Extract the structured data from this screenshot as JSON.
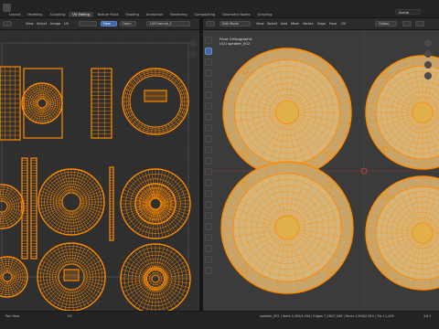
{
  "app": {
    "workspaces": [
      "Layout",
      "Modeling",
      "Sculpting",
      "UV Editing",
      "Texture Paint",
      "Shading",
      "Animation",
      "Rendering",
      "Compositing",
      "Geometry Nodes",
      "Scripting"
    ],
    "active_workspace": "UV Editing",
    "scene_name": "Scene"
  },
  "uv_editor": {
    "header": {
      "mode": "View",
      "menus": [
        "View",
        "Select",
        "Image",
        "UV"
      ],
      "pivot": "Sync",
      "image_name": "UVChannel_1",
      "shading_label": "New",
      "open_label": "Open"
    }
  },
  "viewport": {
    "header": {
      "mode": "Edit Mode",
      "menus": [
        "View",
        "Select",
        "Add",
        "Mesh",
        "Vertex",
        "Edge",
        "Face",
        "UV"
      ],
      "transform_orientation": "Global"
    },
    "overlay_title": "Front Orthographic",
    "overlay_subtitle": "(41) speaker_002"
  },
  "status_bar": {
    "left": "Pan View",
    "middle": "UV",
    "stats": "speaker_002 | Verts 4,304/4,304 | Edges 7,248/7,248 | Faces 2,944/2,944 | Tris 11,426",
    "version": "3.6.1"
  },
  "colors": {
    "uv_background": "#2f2f2f",
    "viewport_background": "#3b3b3b",
    "mesh_edges": "#ff8a00",
    "mesh_fill": "#c8a56a",
    "selected_tool": "#3f68a8"
  },
  "icons": [
    "editor-type-icon",
    "image-icon",
    "zoom-icon",
    "hand-icon",
    "cursor-icon",
    "select-box-icon",
    "move-icon",
    "rotate-icon",
    "scale-icon",
    "transform-icon",
    "annotate-icon",
    "measure-icon",
    "add-cube-icon",
    "extrude-icon",
    "inset-icon",
    "bevel-icon",
    "loop-cut-icon",
    "knife-icon",
    "poly-build-icon",
    "spin-icon",
    "smooth-icon",
    "edge-slide-icon",
    "shrink-icon",
    "shear-icon",
    "rip-icon",
    "3d-cursor-icon"
  ]
}
